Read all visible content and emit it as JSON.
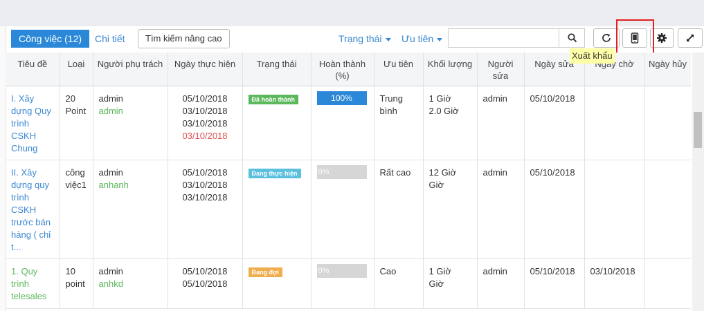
{
  "toolbar": {
    "tab_active": "Công việc (12)",
    "tab_detail": "Chi tiết",
    "advanced_search": "Tìm kiếm nâng cao",
    "status_filter": "Trạng thái",
    "priority_filter": "Ưu tiên",
    "search_value": "",
    "tooltip": "Xuất khẩu"
  },
  "icons": {
    "search": "search-icon",
    "refresh": "refresh-icon",
    "export": "mobile-export-icon",
    "settings": "gear-icon",
    "expand": "expand-icon"
  },
  "colors": {
    "accent": "#2b88d8",
    "done": "#5cb85c",
    "doing": "#5bc0de",
    "waiting": "#f0ad4e",
    "highlight": "#e02020",
    "overdue": "#e05050"
  },
  "table": {
    "headers": [
      "Tiêu đề",
      "Loại",
      "Người phụ trách",
      "Ngày thực hiện",
      "Trạng thái",
      "Hoàn thành (%)",
      "Ưu tiên",
      "Khối lượng",
      "Người sửa",
      "Ngày sửa",
      "Ngày chờ",
      "Ngày hủy"
    ],
    "rows": [
      {
        "title_lines": [
          "I. Xây",
          "dựng Quy",
          "trình",
          "CSKH",
          "Chung"
        ],
        "type_lines": [
          "20",
          "Point"
        ],
        "owner": "admin",
        "assignee": "admin",
        "dates": [
          "05/10/2018",
          "03/10/2018",
          "03/10/2018"
        ],
        "date_overdue": "03/10/2018",
        "status": "Đã hoàn thành",
        "progress": 100,
        "progress_label": "100%",
        "priority_lines": [
          "Trung",
          "bình"
        ],
        "volume_lines": [
          "1 Giờ",
          "2.0 Giờ"
        ],
        "editor": "admin",
        "edit_date": "05/10/2018",
        "wait_date": "",
        "cancel_date": ""
      },
      {
        "title_lines": [
          "II. Xây",
          "dựng quy",
          "trình",
          "CSKH",
          "trước bán",
          "hàng ( chỉ",
          "t..."
        ],
        "type_lines": [
          "công",
          "việc1"
        ],
        "owner": "admin",
        "assignee": "anhanh",
        "dates": [
          "05/10/2018",
          "03/10/2018",
          "03/10/2018"
        ],
        "date_overdue": "",
        "status": "Đang thực hiện",
        "progress": 0,
        "progress_label": "0%",
        "priority_lines": [
          "Rất cao",
          ""
        ],
        "volume_lines": [
          "12 Giờ",
          "Giờ"
        ],
        "editor": "admin",
        "edit_date": "05/10/2018",
        "wait_date": "",
        "cancel_date": ""
      },
      {
        "title_lines": [
          "1. Quy",
          "trình",
          "telesales"
        ],
        "type_lines": [
          "10",
          "point"
        ],
        "owner": "admin",
        "assignee": "anhkd",
        "dates": [
          "05/10/2018",
          "05/10/2018"
        ],
        "date_overdue": "",
        "status": "Đang đợi",
        "progress": 0,
        "progress_label": "0%",
        "priority_lines": [
          "Cao",
          ""
        ],
        "volume_lines": [
          "1 Giờ",
          "Giờ"
        ],
        "editor": "admin",
        "edit_date": "05/10/2018",
        "wait_date": "03/10/2018",
        "cancel_date": ""
      }
    ]
  }
}
